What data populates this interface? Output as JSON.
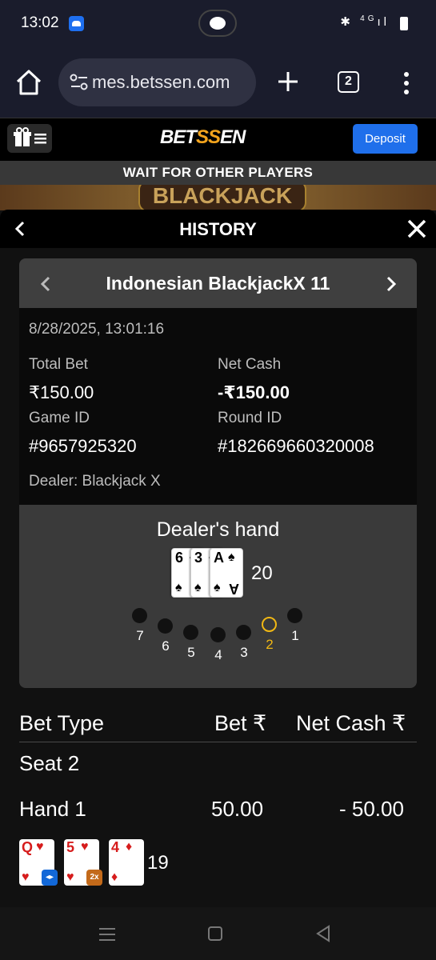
{
  "status_bar": {
    "time": "13:02",
    "network": "4G"
  },
  "browser": {
    "url": "mes.betssen.com",
    "tab_count": "2"
  },
  "site": {
    "logo_part1": "BET",
    "logo_part2": "SS",
    "logo_part3": "EN",
    "deposit_label": "Deposit",
    "wait_message": "WAIT FOR OTHER PLAYERS",
    "banner_text": "BLACKJACK"
  },
  "history": {
    "title": "HISTORY",
    "game_title": "Indonesian BlackjackX 11",
    "datetime": "8/28/2025, 13:01:16",
    "total_bet_label": "Total Bet",
    "total_bet_value": "₹150.00",
    "net_cash_label": "Net Cash",
    "net_cash_value": "-₹150.00",
    "game_id_label": "Game ID",
    "game_id_value": "#9657925320",
    "round_id_label": "Round ID",
    "round_id_value": "#182669660320008",
    "dealer_line": "Dealer: Blackjack X",
    "dealer_hand_title": "Dealer's hand",
    "dealer_cards": [
      {
        "rank": "6",
        "suit": "♠",
        "color": "black"
      },
      {
        "rank": "3",
        "suit": "♠",
        "color": "black"
      },
      {
        "rank": "A",
        "suit": "♠",
        "color": "black"
      }
    ],
    "dealer_total": "20",
    "seats": [
      {
        "number": "7",
        "active": false
      },
      {
        "number": "6",
        "active": false
      },
      {
        "number": "5",
        "active": false
      },
      {
        "number": "4",
        "active": false
      },
      {
        "number": "3",
        "active": false
      },
      {
        "number": "2",
        "active": true
      },
      {
        "number": "1",
        "active": false
      }
    ],
    "active_seat_color": "#f1b814",
    "bet_table": {
      "col_bet_type": "Bet Type",
      "col_bet": "Bet ₹",
      "col_net_cash": "Net Cash ₹",
      "seat_label": "Seat 2",
      "hand_label": "Hand 1",
      "hand_bet": "50.00",
      "hand_net": "- 50.00",
      "hand_cards": [
        {
          "rank": "Q",
          "suit": "♥",
          "badge": "split-icon"
        },
        {
          "rank": "5",
          "suit": "♥",
          "badge": "2x"
        },
        {
          "rank": "4",
          "suit": "♦",
          "badge": ""
        }
      ],
      "hand_total": "19"
    }
  },
  "colors": {
    "accent": "#1f6feb",
    "brand": "#f3a41d",
    "background": "#111111"
  }
}
